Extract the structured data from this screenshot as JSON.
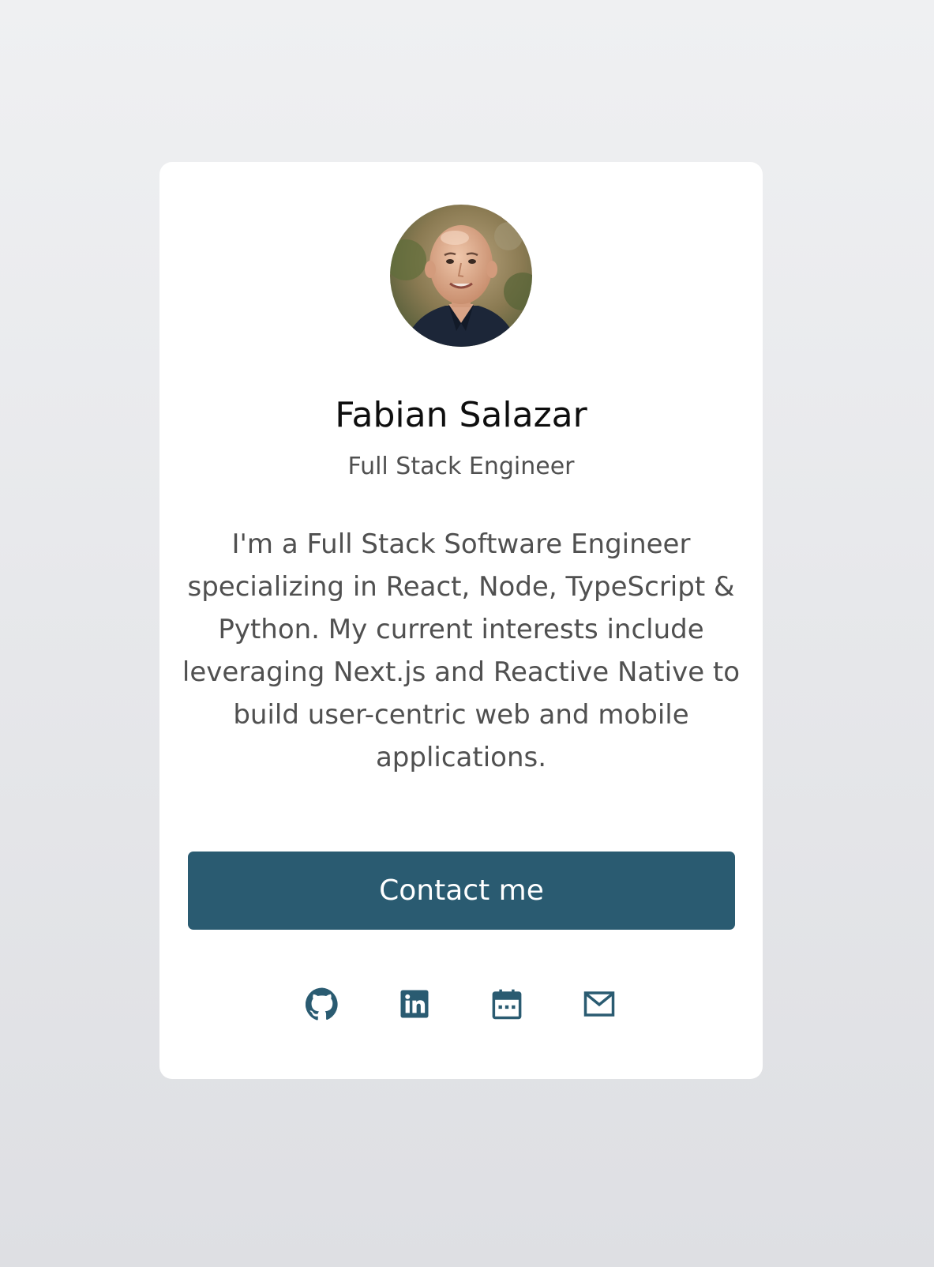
{
  "profile": {
    "name": "Fabian Salazar",
    "role": "Full Stack Engineer",
    "bio": "I'm a Full Stack Software Engineer\nspecializing in React, Node, TypeScript &\nPython. My current interests include\nleveraging Next.js and Reactive Native to\nbuild user-centric web and mobile\napplications."
  },
  "actions": {
    "contact_label": "Contact me"
  },
  "social": [
    {
      "icon": "github-icon"
    },
    {
      "icon": "linkedin-icon"
    },
    {
      "icon": "calendar-icon"
    },
    {
      "icon": "mail-icon"
    }
  ],
  "colors": {
    "accent": "#2a5b71",
    "card": "#ffffff",
    "text_primary": "#0e0e0e",
    "text_secondary": "#505050",
    "background_top": "#eff0f2",
    "background_bottom": "#dedfe3"
  }
}
